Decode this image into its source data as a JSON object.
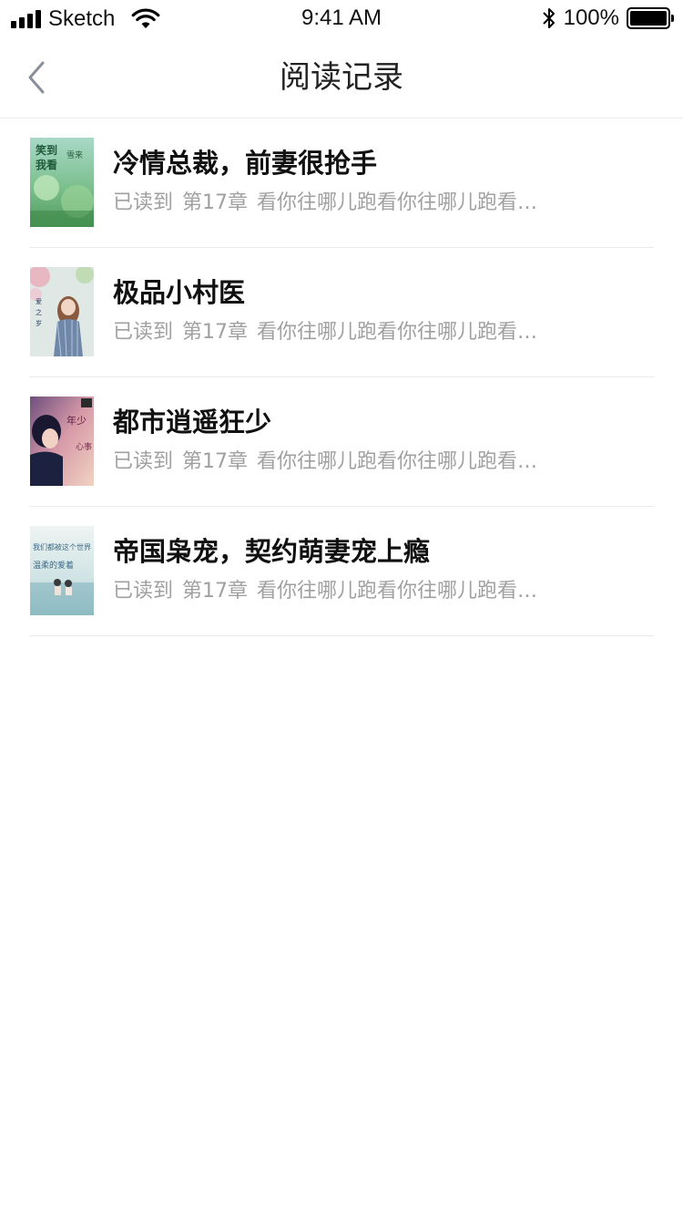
{
  "status_bar": {
    "carrier": "Sketch",
    "time": "9:41 AM",
    "battery": "100%"
  },
  "nav": {
    "title": "阅读记录",
    "back_icon": "chevron-left-icon"
  },
  "history": [
    {
      "title": "冷情总裁，前妻很抢手",
      "read_label": "已读到",
      "chapter": "第17章",
      "excerpt": "看你往哪儿跑看你往哪儿跑看你往哪儿跑",
      "cover_text": "笑到我看雪来"
    },
    {
      "title": "极品小村医",
      "read_label": "已读到",
      "chapter": "第17章",
      "excerpt": "看你往哪儿跑看你往哪儿跑看你往哪儿跑",
      "cover_text": ""
    },
    {
      "title": "都市逍遥狂少",
      "read_label": "已读到",
      "chapter": "第17章",
      "excerpt": "看你往哪儿跑看你往哪儿跑看你往哪儿跑",
      "cover_text": "年少"
    },
    {
      "title": "帝国枭宠，契约萌妻宠上瘾",
      "read_label": "已读到",
      "chapter": "第17章",
      "excerpt": "看你往哪儿跑看你往哪儿跑看你往哪儿跑",
      "cover_text": "我们都被这个世界温柔的爱着"
    }
  ]
}
